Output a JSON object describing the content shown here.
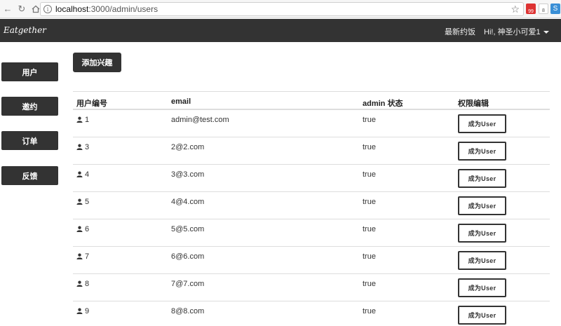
{
  "browser": {
    "url_host": "localhost",
    "url_path": ":3000/admin/users",
    "ext_badge_1": "99",
    "ext_badge_2": "8"
  },
  "navbar": {
    "brand": "Eatgether",
    "latest_link": "最新约饭",
    "user_greeting": "Hi!, 神圣小可爱1"
  },
  "sidebar": {
    "items": [
      {
        "label": "用户"
      },
      {
        "label": "邀约"
      },
      {
        "label": "订单"
      },
      {
        "label": "反馈"
      }
    ]
  },
  "main": {
    "add_interest_label": "添加兴趣",
    "table": {
      "headers": [
        "用户编号",
        "email",
        "admin 状态",
        "权限编辑"
      ],
      "role_button_label": "成为User",
      "rows": [
        {
          "id": "1",
          "email": "admin@test.com",
          "admin": "true"
        },
        {
          "id": "3",
          "email": "2@2.com",
          "admin": "true"
        },
        {
          "id": "4",
          "email": "3@3.com",
          "admin": "true"
        },
        {
          "id": "5",
          "email": "4@4.com",
          "admin": "true"
        },
        {
          "id": "6",
          "email": "5@5.com",
          "admin": "true"
        },
        {
          "id": "7",
          "email": "6@6.com",
          "admin": "true"
        },
        {
          "id": "8",
          "email": "7@7.com",
          "admin": "true"
        },
        {
          "id": "9",
          "email": "8@8.com",
          "admin": "true"
        }
      ]
    }
  }
}
